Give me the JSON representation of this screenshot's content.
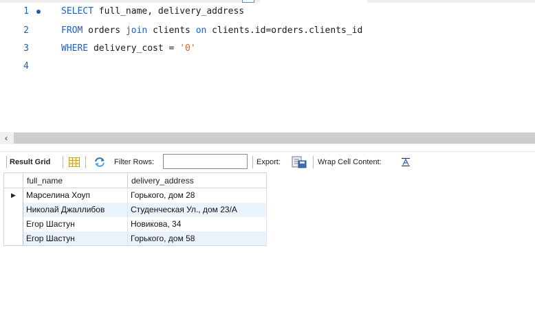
{
  "editor": {
    "lines": [
      {
        "num": "1",
        "has_marker": true,
        "tokens": [
          {
            "t": "SELECT",
            "k": "kw"
          },
          {
            "t": " full_name, delivery_address",
            "k": ""
          }
        ]
      },
      {
        "num": "2",
        "has_marker": false,
        "tokens": [
          {
            "t": "FROM",
            "k": "kw"
          },
          {
            "t": " orders ",
            "k": ""
          },
          {
            "t": "join",
            "k": "kw"
          },
          {
            "t": " clients ",
            "k": ""
          },
          {
            "t": "on",
            "k": "kw"
          },
          {
            "t": " clients.id=orders.clients_id",
            "k": ""
          }
        ]
      },
      {
        "num": "3",
        "has_marker": false,
        "tokens": [
          {
            "t": "WHERE",
            "k": "kw"
          },
          {
            "t": " delivery_cost = ",
            "k": ""
          },
          {
            "t": "'0'",
            "k": "str"
          }
        ]
      },
      {
        "num": "4",
        "has_marker": false,
        "tokens": []
      }
    ]
  },
  "scrollbar": {
    "left_arrow": "‹"
  },
  "toolbar": {
    "result_grid_label": "Result Grid",
    "filter_label": "Filter Rows:",
    "filter_value": "",
    "export_label": "Export:",
    "wrap_label": "Wrap Cell Content:"
  },
  "grid": {
    "columns": [
      "full_name",
      "delivery_address"
    ],
    "current_row_marker": "▶",
    "rows": [
      [
        "Марселина Хоуп",
        "Горького, дом 28"
      ],
      [
        "Николай Джаллибов",
        "Студенческая Ул., дом 23/А"
      ],
      [
        "Егор Шастун",
        "Новикова, 34"
      ],
      [
        "Егор Шастун",
        "Горького, дом 58"
      ]
    ]
  },
  "colors": {
    "keyword": "#1f5fc7",
    "string": "#d2691e",
    "line_number": "#1a63a8",
    "alt_row": "#eaf2fb"
  }
}
